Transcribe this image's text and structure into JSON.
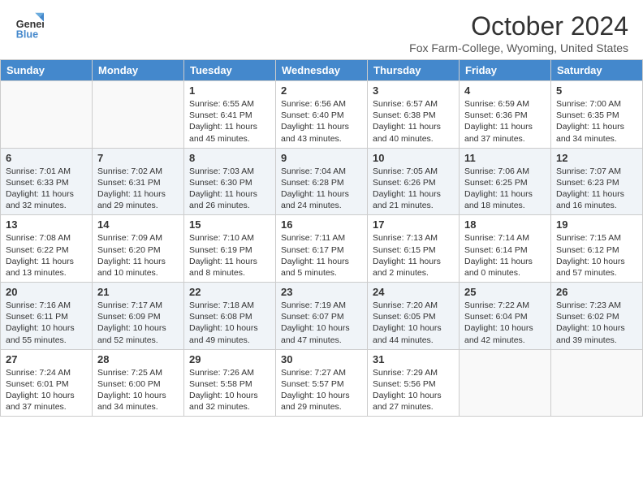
{
  "header": {
    "logo_general": "General",
    "logo_blue": "Blue",
    "month_title": "October 2024",
    "subtitle": "Fox Farm-College, Wyoming, United States"
  },
  "days_of_week": [
    "Sunday",
    "Monday",
    "Tuesday",
    "Wednesday",
    "Thursday",
    "Friday",
    "Saturday"
  ],
  "weeks": [
    [
      {
        "day": "",
        "info": ""
      },
      {
        "day": "",
        "info": ""
      },
      {
        "day": "1",
        "info": "Sunrise: 6:55 AM\nSunset: 6:41 PM\nDaylight: 11 hours and 45 minutes."
      },
      {
        "day": "2",
        "info": "Sunrise: 6:56 AM\nSunset: 6:40 PM\nDaylight: 11 hours and 43 minutes."
      },
      {
        "day": "3",
        "info": "Sunrise: 6:57 AM\nSunset: 6:38 PM\nDaylight: 11 hours and 40 minutes."
      },
      {
        "day": "4",
        "info": "Sunrise: 6:59 AM\nSunset: 6:36 PM\nDaylight: 11 hours and 37 minutes."
      },
      {
        "day": "5",
        "info": "Sunrise: 7:00 AM\nSunset: 6:35 PM\nDaylight: 11 hours and 34 minutes."
      }
    ],
    [
      {
        "day": "6",
        "info": "Sunrise: 7:01 AM\nSunset: 6:33 PM\nDaylight: 11 hours and 32 minutes."
      },
      {
        "day": "7",
        "info": "Sunrise: 7:02 AM\nSunset: 6:31 PM\nDaylight: 11 hours and 29 minutes."
      },
      {
        "day": "8",
        "info": "Sunrise: 7:03 AM\nSunset: 6:30 PM\nDaylight: 11 hours and 26 minutes."
      },
      {
        "day": "9",
        "info": "Sunrise: 7:04 AM\nSunset: 6:28 PM\nDaylight: 11 hours and 24 minutes."
      },
      {
        "day": "10",
        "info": "Sunrise: 7:05 AM\nSunset: 6:26 PM\nDaylight: 11 hours and 21 minutes."
      },
      {
        "day": "11",
        "info": "Sunrise: 7:06 AM\nSunset: 6:25 PM\nDaylight: 11 hours and 18 minutes."
      },
      {
        "day": "12",
        "info": "Sunrise: 7:07 AM\nSunset: 6:23 PM\nDaylight: 11 hours and 16 minutes."
      }
    ],
    [
      {
        "day": "13",
        "info": "Sunrise: 7:08 AM\nSunset: 6:22 PM\nDaylight: 11 hours and 13 minutes."
      },
      {
        "day": "14",
        "info": "Sunrise: 7:09 AM\nSunset: 6:20 PM\nDaylight: 11 hours and 10 minutes."
      },
      {
        "day": "15",
        "info": "Sunrise: 7:10 AM\nSunset: 6:19 PM\nDaylight: 11 hours and 8 minutes."
      },
      {
        "day": "16",
        "info": "Sunrise: 7:11 AM\nSunset: 6:17 PM\nDaylight: 11 hours and 5 minutes."
      },
      {
        "day": "17",
        "info": "Sunrise: 7:13 AM\nSunset: 6:15 PM\nDaylight: 11 hours and 2 minutes."
      },
      {
        "day": "18",
        "info": "Sunrise: 7:14 AM\nSunset: 6:14 PM\nDaylight: 11 hours and 0 minutes."
      },
      {
        "day": "19",
        "info": "Sunrise: 7:15 AM\nSunset: 6:12 PM\nDaylight: 10 hours and 57 minutes."
      }
    ],
    [
      {
        "day": "20",
        "info": "Sunrise: 7:16 AM\nSunset: 6:11 PM\nDaylight: 10 hours and 55 minutes."
      },
      {
        "day": "21",
        "info": "Sunrise: 7:17 AM\nSunset: 6:09 PM\nDaylight: 10 hours and 52 minutes."
      },
      {
        "day": "22",
        "info": "Sunrise: 7:18 AM\nSunset: 6:08 PM\nDaylight: 10 hours and 49 minutes."
      },
      {
        "day": "23",
        "info": "Sunrise: 7:19 AM\nSunset: 6:07 PM\nDaylight: 10 hours and 47 minutes."
      },
      {
        "day": "24",
        "info": "Sunrise: 7:20 AM\nSunset: 6:05 PM\nDaylight: 10 hours and 44 minutes."
      },
      {
        "day": "25",
        "info": "Sunrise: 7:22 AM\nSunset: 6:04 PM\nDaylight: 10 hours and 42 minutes."
      },
      {
        "day": "26",
        "info": "Sunrise: 7:23 AM\nSunset: 6:02 PM\nDaylight: 10 hours and 39 minutes."
      }
    ],
    [
      {
        "day": "27",
        "info": "Sunrise: 7:24 AM\nSunset: 6:01 PM\nDaylight: 10 hours and 37 minutes."
      },
      {
        "day": "28",
        "info": "Sunrise: 7:25 AM\nSunset: 6:00 PM\nDaylight: 10 hours and 34 minutes."
      },
      {
        "day": "29",
        "info": "Sunrise: 7:26 AM\nSunset: 5:58 PM\nDaylight: 10 hours and 32 minutes."
      },
      {
        "day": "30",
        "info": "Sunrise: 7:27 AM\nSunset: 5:57 PM\nDaylight: 10 hours and 29 minutes."
      },
      {
        "day": "31",
        "info": "Sunrise: 7:29 AM\nSunset: 5:56 PM\nDaylight: 10 hours and 27 minutes."
      },
      {
        "day": "",
        "info": ""
      },
      {
        "day": "",
        "info": ""
      }
    ]
  ]
}
